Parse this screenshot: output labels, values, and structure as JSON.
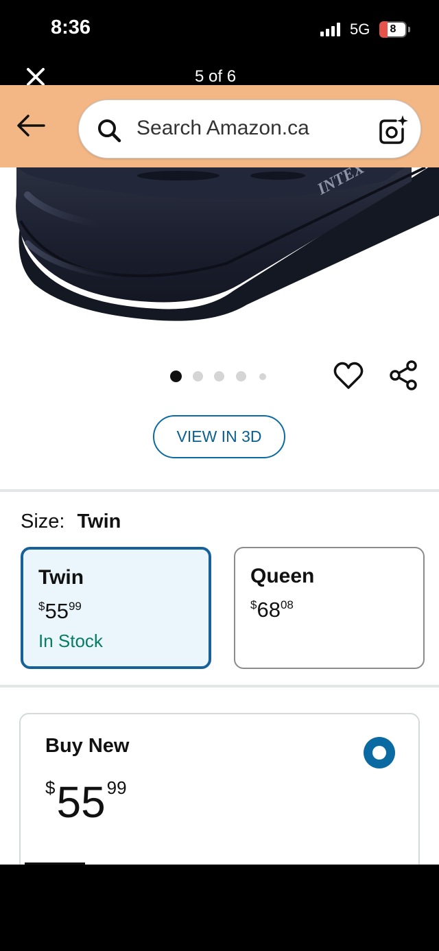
{
  "status_bar": {
    "time": "8:36",
    "network": "5G",
    "battery": "8"
  },
  "viewer": {
    "counter": "5 of 6"
  },
  "search": {
    "placeholder": "Search Amazon.ca"
  },
  "product_image": {
    "brand_mark": "INTEX"
  },
  "carousel": {
    "total_dots": 5,
    "active_index": 0
  },
  "view3d": {
    "label": "VIEW IN 3D"
  },
  "size": {
    "label": "Size:",
    "selected": "Twin",
    "options": [
      {
        "name": "Twin",
        "currency": "$",
        "whole": "55",
        "cents": "99",
        "stock": "In Stock",
        "selected": true
      },
      {
        "name": "Queen",
        "currency": "$",
        "whole": "68",
        "cents": "08",
        "stock": "",
        "selected": false
      }
    ]
  },
  "buy_new": {
    "title": "Buy New",
    "currency": "$",
    "whole": "55",
    "cents": "99",
    "selected": true
  },
  "colors": {
    "header_bg": "#f3b785",
    "accent_blue": "#0a6aa1",
    "stock_green": "#067d62",
    "selected_card_bg": "#eaf5fc"
  }
}
